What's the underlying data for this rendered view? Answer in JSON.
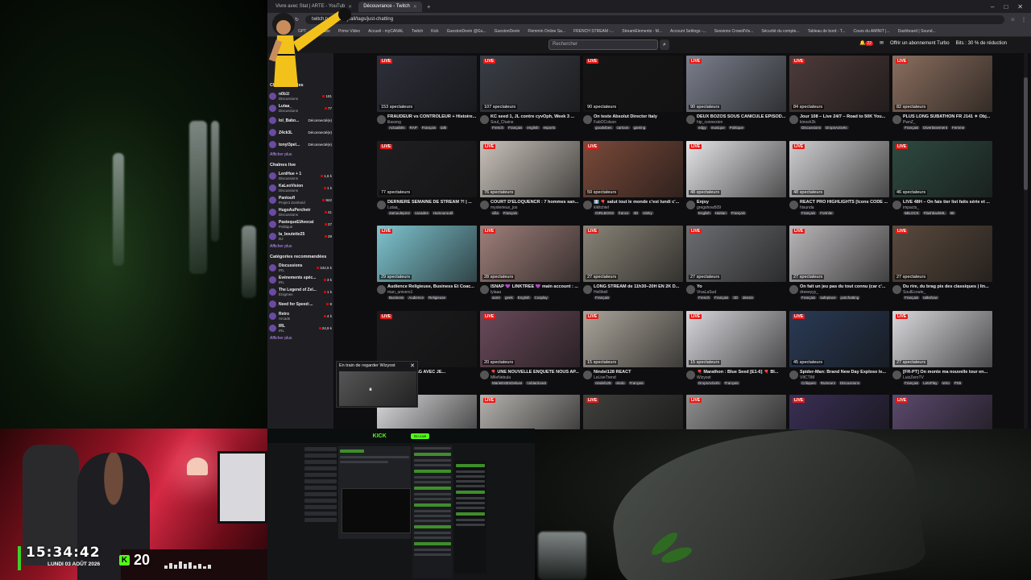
{
  "browser": {
    "tabs": [
      {
        "label": "Vivre avec Stat | ARTE - YouTub",
        "active": false
      },
      {
        "label": "Découvrance - Twitch",
        "active": true
      }
    ],
    "url": "twitch.tv/directory/all/tags/just-chatting",
    "bookmarks": [
      "GPT",
      "YouTube",
      "Prime Video",
      "Accueil - myCANAL",
      "Twitch",
      "Kick",
      "GuestonDevin @Gu...",
      "GuestonDevin",
      "Flemmin Online Sa...",
      "FRENCH STREAM -...",
      "StreamElements - M...",
      "Account Settings -...",
      "Sessions Crowd/Vis...",
      "Sécurité du compte...",
      "Tableau de bord - T...",
      "Cours du AMINIT |...",
      "Dashboard | Sound..."
    ]
  },
  "twitch": {
    "search_placeholder": "Rechercher",
    "notification_count": "22",
    "turbo_label": "Offrir un abonnement Turbo",
    "bits_label": "Bits : 30 % de réduction"
  },
  "sidebar": {
    "followed_header": "Chaînes suivies",
    "followed": [
      {
        "name": "n0b1l",
        "category": "Discussions",
        "count": "181",
        "live": true
      },
      {
        "name": "Lutaa_",
        "category": "Discussions",
        "count": "77",
        "live": true
      },
      {
        "name": "lol_Babo...",
        "category": "",
        "count": "Déconnecté(e)",
        "live": false
      },
      {
        "name": "Z4ck3L",
        "category": "",
        "count": "Déconnecté(e)",
        "live": false
      },
      {
        "name": "tonyl3pel...",
        "category": "",
        "count": "Déconnecté(e)",
        "live": false
      }
    ],
    "followed_more": "Afficher plus",
    "live_header": "Chaînes live",
    "live": [
      {
        "name": "LeniHue + 1",
        "category": "Discussions",
        "count": "1,6 k"
      },
      {
        "name": "KaLeoVision",
        "category": "Discussions",
        "count": "1 k"
      },
      {
        "name": "Pantoufl",
        "category": "Project Zomboid",
        "count": "842"
      },
      {
        "name": "HugoAuPercheir",
        "category": "Discussions",
        "count": "41"
      },
      {
        "name": "PastequeElAvocat",
        "category": "Politique",
        "count": "27"
      },
      {
        "name": "la_boutette25",
        "category": "DJ",
        "count": "29"
      }
    ],
    "live_more": "Afficher plus",
    "cat_header": "Catégories recommandées",
    "categories": [
      {
        "name": "Discussions",
        "category": "IRL",
        "count": "342,5 k"
      },
      {
        "name": "Événements spéc...",
        "category": "IRL",
        "count": "3 k"
      },
      {
        "name": "The Legend of Zel...",
        "category": "Énigmes",
        "count": "1 k"
      },
      {
        "name": "Need for Speed:...",
        "category": "",
        "count": "8"
      },
      {
        "name": "Retro",
        "category": "Arcade",
        "count": "4 k"
      },
      {
        "name": "IRL",
        "category": "IRL",
        "count": "24,9 k"
      }
    ],
    "cat_more": "Afficher plus"
  },
  "miniplayer": {
    "title": "En train de regarder Wizyost"
  },
  "streams": [
    {
      "viewers": "153 spectateurs",
      "title": "FRAUDEUR vs CONTROLEUR + Histoire...",
      "channel": "lilasong",
      "tags": [
        "Actualités",
        "RAP",
        "Français",
        "talk"
      ],
      "color": "#2d2f3a"
    },
    {
      "viewers": "107 spectateurs",
      "title": "KC seed 1, JL contre cyvOph, Week 3 ...",
      "channel": "Soul_Chains",
      "tags": [
        "French",
        "Français",
        "english",
        "esports"
      ],
      "color": "#3a3d45"
    },
    {
      "viewers": "90 spectateurs",
      "title": "On teste Absolut Director Italy",
      "channel": "FabOColson",
      "tags": [
        "goodvibes",
        "cartoon",
        "gaming"
      ],
      "color": "#151515"
    },
    {
      "viewers": "90 spectateurs",
      "title": "DEUX BOZOS SOUS CANICULE EPISOD...",
      "channel": "hip_connexion",
      "tags": [
        "edgy",
        "musique",
        "Politique"
      ],
      "color": "#7b7f8c"
    },
    {
      "viewers": "84 spectateurs",
      "title": "Jour 108 – Live 24/7 – Road to 50K You...",
      "channel": "kinosh2k",
      "tags": [
        "Discussions",
        "DropsActivés"
      ],
      "color": "#4d3b3a"
    },
    {
      "viewers": "82 spectateurs",
      "title": "PLUS LONG SUBATHON FR J141 ✦ Obj...",
      "channel": "PwnZ_",
      "tags": [
        "Français",
        "Divertissement",
        "Femme"
      ],
      "color": "#8a6e5e"
    },
    {
      "viewers": "77 spectateurs",
      "title": "DERNIÈRE SEMAINE DE STREAM ?! | ...",
      "channel": "Lutaa_",
      "tags": [
        "2amouleprez",
        "cacades",
        "Humouroutil"
      ],
      "color": "#1f1f22"
    },
    {
      "viewers": "76 spectateurs",
      "title": "COURT D'ELOQUENCR : 7 hommes san...",
      "channel": "mysterieux_jos",
      "tags": [
        "villa",
        "Français"
      ],
      "color": "#c9c2ba"
    },
    {
      "viewers": "59 spectateurs",
      "title": "ℹ️ 🎈 salut tout le monde c'est lundi c'...",
      "channel": "klkltchiel",
      "tags": [
        "GIRLBOSS",
        "france",
        "3D",
        "stinky"
      ],
      "color": "#7a4a3a"
    },
    {
      "viewers": "48 spectateurs",
      "title": "Enjoy",
      "channel": "gregshow509",
      "tags": [
        "English",
        "Haitian",
        "Français"
      ],
      "color": "#e5e5e8"
    },
    {
      "viewers": "48 spectateurs",
      "title": "REACT PRO HIGHLIGHTS [Icons CODE ...",
      "channel": "hisunda",
      "tags": [
        "Français",
        "Fortnite"
      ],
      "color": "#cfcfd1"
    },
    {
      "viewers": "46 spectateurs",
      "title": "LIVE 48H – On fais tier list faits série et ...",
      "channel": "impacts_",
      "tags": [
        "6BLOCK",
        "FlashbackML",
        "88"
      ],
      "color": "#2e4a40"
    },
    {
      "viewers": "29 spectateurs",
      "title": "Audience Religieuse, Business Et Coac...",
      "channel": "man_univers1",
      "tags": [
        "Business",
        "Audience",
        "Religieuse"
      ],
      "color": "#7ec4cf"
    },
    {
      "viewers": "28 spectateurs",
      "title": "ISNAP 💜 LINKTREE 💜 main account : ...",
      "channel": "lylaaa",
      "tags": [
        "asmr",
        "geek",
        "English",
        "Cosplay"
      ],
      "color": "#9e7f7a"
    },
    {
      "viewers": "27 spectateurs",
      "title": "LONG STREAM de 11h30–20H EN 2K D...",
      "channel": "Hellihell",
      "tags": [
        "Français"
      ],
      "color": "#8a8478"
    },
    {
      "viewers": "27 spectateurs",
      "title": "Yo",
      "channel": "VivaLaSud",
      "tags": [
        "French",
        "Français",
        "3D",
        "dessin"
      ],
      "color": "#6d6e72"
    },
    {
      "viewers": "27 spectateurs",
      "title": "On fait un jeu pas du tout connu (car c'...",
      "channel": "dreeeyyy_",
      "tags": [
        "Français",
        "safeplace",
        "justchatting"
      ],
      "color": "#b9b6b8"
    },
    {
      "viewers": "27 spectateurs",
      "title": "Du rire, du brag pis des classiques | lin...",
      "channel": "SoulEcoute_",
      "tags": [
        "Français",
        "talkshow"
      ],
      "color": "#5a4a3e"
    },
    {
      "viewers": "",
      "title": "FLAG/REDFLAG AVEC JE...",
      "channel": "",
      "tags": [],
      "color": "#1b1b1d"
    },
    {
      "viewers": "20 spectateurs",
      "title": "🎈 UNE NOUVELLE ENQUÊTE NOUS AP...",
      "channel": "MlleNebula",
      "tags": [
        "MarieEstEnDeluxe",
        "noblackcast"
      ],
      "color": "#6a4a5a"
    },
    {
      "viewers": "15 spectateurs",
      "title": "Nindel128 REACT",
      "channel": "LeLiveTrend",
      "tags": [
        "nindel128",
        "nindo",
        "Français"
      ],
      "color": "#aaa49a"
    },
    {
      "viewers": "15 spectateurs",
      "title": "🎈 Marathon : Blue Seed [E1-6] 🎈 BI...",
      "channel": "Wizyost",
      "tags": [
        "DropsActivés",
        "Français"
      ],
      "color": "#d7d7dc"
    },
    {
      "viewers": "45 spectateurs",
      "title": "Spider-Man: Brand New Day Explose le...",
      "channel": "VIICTIM",
      "tags": [
        "Critiques",
        "Rumeurs",
        "Discussions"
      ],
      "color": "#2a3a55"
    },
    {
      "viewers": "27 spectateurs",
      "title": "[FR-PT] On monte ma nouvelle tour en...",
      "channel": "LuizZeroTV",
      "tags": [
        "Français",
        "LetsPlay",
        "retro",
        "PS5"
      ],
      "color": "#d9d9dd"
    },
    {
      "viewers": "",
      "title": "",
      "channel": "",
      "tags": [],
      "color": "#dcdcde"
    },
    {
      "viewers": "",
      "title": "",
      "channel": "",
      "tags": [],
      "color": "#b5b2ae"
    },
    {
      "viewers": "",
      "title": "",
      "channel": "",
      "tags": [],
      "color": "#3f403c"
    },
    {
      "viewers": "",
      "title": "",
      "channel": "",
      "tags": [],
      "color": "#8e8e8e"
    },
    {
      "viewers": "",
      "title": "",
      "channel": "",
      "tags": [],
      "color": "#3a2f55"
    },
    {
      "viewers": "",
      "title": "",
      "channel": "",
      "tags": [],
      "color": "#5c4a6e"
    }
  ],
  "overlay": {
    "time": "15:34:42",
    "date": "LUNDI 03 AOÛT 2026",
    "kick_letter": "K",
    "viewer_count": "20"
  },
  "kick_panel": {
    "logo": "KICK",
    "go_live": "Go Live"
  }
}
